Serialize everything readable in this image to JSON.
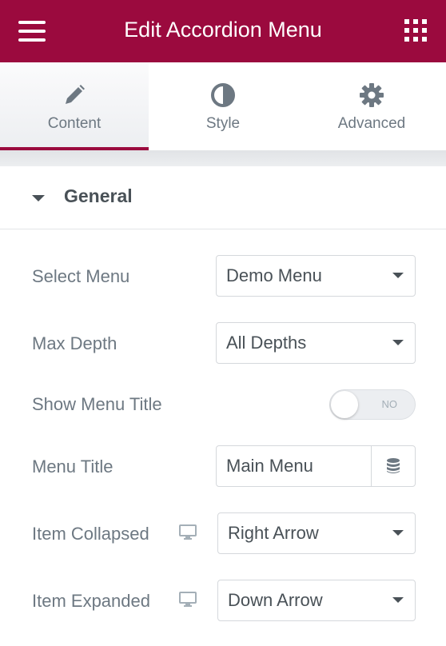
{
  "header": {
    "title": "Edit Accordion Menu",
    "menu_icon": "hamburger-icon",
    "apps_icon": "grid-icon"
  },
  "tabs": [
    {
      "label": "Content",
      "icon": "pencil-icon",
      "active": true
    },
    {
      "label": "Style",
      "icon": "half-circle-icon",
      "active": false
    },
    {
      "label": "Advanced",
      "icon": "gear-icon",
      "active": false
    }
  ],
  "section": {
    "title": "General",
    "expanded": true
  },
  "fields": {
    "select_menu": {
      "label": "Select Menu",
      "value": "Demo Menu"
    },
    "max_depth": {
      "label": "Max Depth",
      "value": "All Depths"
    },
    "show_menu_title": {
      "label": "Show Menu Title",
      "state": "NO"
    },
    "menu_title": {
      "label": "Menu Title",
      "value": "Main Menu",
      "icon": "database-icon"
    },
    "item_collapsed": {
      "label": "Item Collapsed",
      "value": "Right Arrow",
      "icon": "desktop-icon"
    },
    "item_expanded": {
      "label": "Item Expanded",
      "value": "Down Arrow",
      "icon": "desktop-icon"
    }
  },
  "colors": {
    "brand": "#9b0a3e",
    "text": "#6d7882",
    "value_text": "#495157"
  }
}
